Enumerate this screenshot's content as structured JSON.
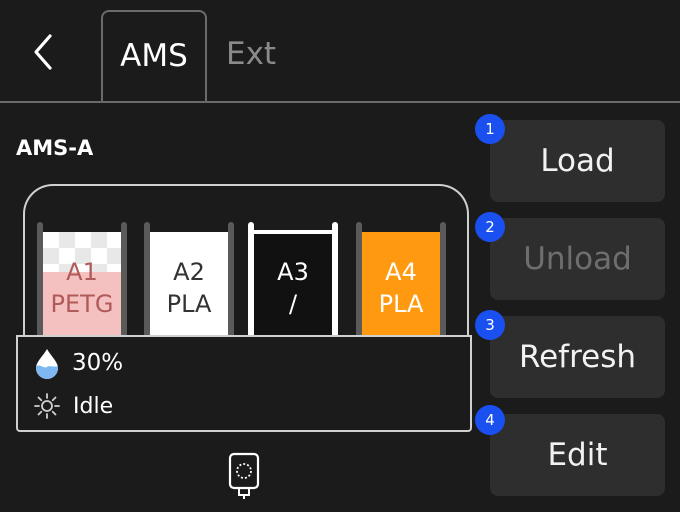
{
  "header": {
    "tabs": [
      {
        "label": "AMS",
        "active": true
      },
      {
        "label": "Ext",
        "active": false
      }
    ]
  },
  "ams": {
    "name": "AMS-A",
    "humidity": "30%",
    "status": "Idle",
    "slots": [
      {
        "id": "A1",
        "material": "PETG",
        "color": "#f5c0c0",
        "selected": false
      },
      {
        "id": "A2",
        "material": "PLA",
        "color": "#ffffff",
        "selected": false
      },
      {
        "id": "A3",
        "material": "/",
        "color": "#111111",
        "selected": true
      },
      {
        "id": "A4",
        "material": "PLA",
        "color": "#ff9a10",
        "selected": false
      }
    ]
  },
  "actions": [
    {
      "number": "1",
      "label": "Load",
      "enabled": true
    },
    {
      "number": "2",
      "label": "Unload",
      "enabled": false
    },
    {
      "number": "3",
      "label": "Refresh",
      "enabled": true
    },
    {
      "number": "4",
      "label": "Edit",
      "enabled": true
    }
  ],
  "icons": {
    "back": "chevron-left-icon",
    "humidity": "water-drop-icon",
    "status": "sun-icon",
    "extruder": "extruder-icon"
  },
  "colors": {
    "background": "#1b1b1b",
    "button": "#2e2e2e",
    "badge": "#1a4ff0",
    "accent_orange": "#ff9a10"
  }
}
